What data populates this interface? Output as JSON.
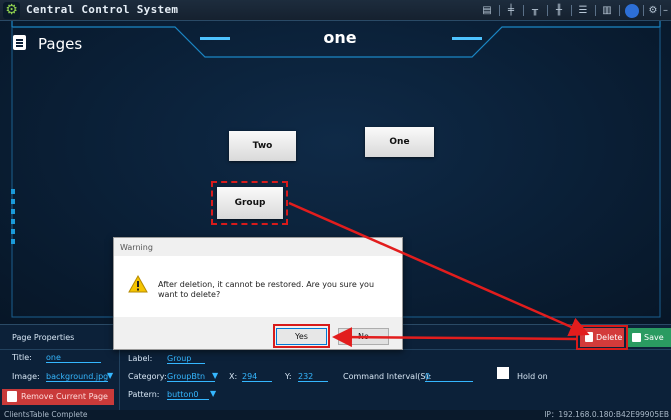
{
  "window": {
    "title": "Central Control System"
  },
  "canvas": {
    "pages_title": "Pages",
    "center_title": "one",
    "buttons": {
      "two": "Two",
      "one": "One",
      "group": "Group"
    }
  },
  "dialog": {
    "title": "Warning",
    "message": "After deletion, it cannot be restored. Are you sure you want to delete?",
    "yes": "Yes",
    "no": "No"
  },
  "props": {
    "heading": "Page Properties",
    "title_label": "Title:",
    "title_value": "one",
    "image_label": "Image:",
    "image_value": "background.jpg",
    "remove_label": "Remove Current Page",
    "label_label": "Label:",
    "label_value": "Group",
    "category_label": "Category:",
    "category_value": "GroupBtn",
    "x_label": "X:",
    "x_value": "294",
    "y_label": "Y:",
    "y_value": "232",
    "cmd_label": "Command Interval(S):",
    "cmd_value": "0",
    "hold_label": "Hold on",
    "pattern_label": "Pattern:",
    "pattern_value": "button0",
    "delete_label": "Delete",
    "save_label": "Save"
  },
  "status": {
    "left": "ClientsTable Complete",
    "right": "IP：192.168.0.180:B42E99905EB"
  },
  "colors": {
    "accent": "#35b7ff",
    "danger": "#d81b1b",
    "save": "#2a9b61"
  }
}
